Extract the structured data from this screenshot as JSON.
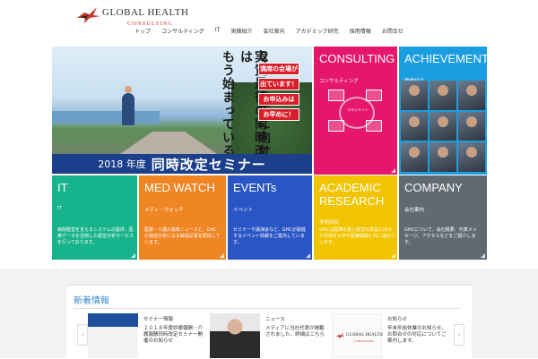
{
  "header": {
    "logo_name": "GLOBAL HEALTH",
    "logo_sub": "CONSULTING",
    "nav": [
      "トップ",
      "コンサルティング",
      "IT",
      "実績紹介",
      "会社案内",
      "アカデミック研究",
      "採用情報",
      "お問合せ"
    ]
  },
  "hero": {
    "vertical_text_1": "２０２５年に向けた",
    "vertical_text_2": "実質最後の同時改定は",
    "vertical_text_3": "もう始まっている―",
    "callout": [
      "満席の会場が",
      "出ています！",
      "お申込みは",
      "お早めに！"
    ],
    "banner_year": "2018 年度",
    "banner_title": "同時改定セミナー"
  },
  "tiles": {
    "consulting": {
      "title": "CONSULTING",
      "sub": "コンサルティング",
      "center": "マネジメント"
    },
    "achievements": {
      "title": "ACHIEVEMENTS",
      "sub": "実績紹介"
    },
    "it": {
      "title": "IT",
      "sub": "IT",
      "desc": "病院経営を支えるシステムの提供、医療データを活用した経営分析サービスを行っております。"
    },
    "medwatch": {
      "title": "MED WATCH",
      "sub": "メディ・ウォッチ",
      "desc": "医療・介護の最新ニュースと、GHCの独自分析による解説記事を配信しています。"
    },
    "events": {
      "title": "EVENTs",
      "sub": "イベント",
      "desc": "セミナーや講演会など、GHCが開催するイベント情報をご案内しています。"
    },
    "academic": {
      "title": "ACADEMIC RESEARCH",
      "sub": "学術研究",
      "desc": "GHCは医療の質と経営の改善に向けた研究を大学や医療機関と共に進めています。"
    },
    "company": {
      "title": "COMPANY",
      "sub": "会社案内",
      "desc": "GHCについて、会社概要、代表メッセージ、アクセスなどをご紹介します。"
    }
  },
  "section": {
    "title": "新着情報",
    "items": [
      {
        "heading": "セミナー情報",
        "body": "２０１８年度診療報酬・介護報酬同時改定セミナー開催のお知らせ"
      },
      {
        "heading": "ニュース",
        "body": "メディアに当社代表が掲載されました。詳細はこちら"
      },
      {
        "heading": "お知らせ",
        "body": "年末年始休業のお知らせ。お問合せの対応についてご案内します。"
      }
    ],
    "prev": "‹",
    "next": "›"
  },
  "colors": {
    "consulting": "#e6166c",
    "achievements": "#1b9de2",
    "it": "#17b38c",
    "medwatch": "#f08524",
    "events": "#2a55c4",
    "academic": "#f2c400",
    "company": "#606a73"
  }
}
